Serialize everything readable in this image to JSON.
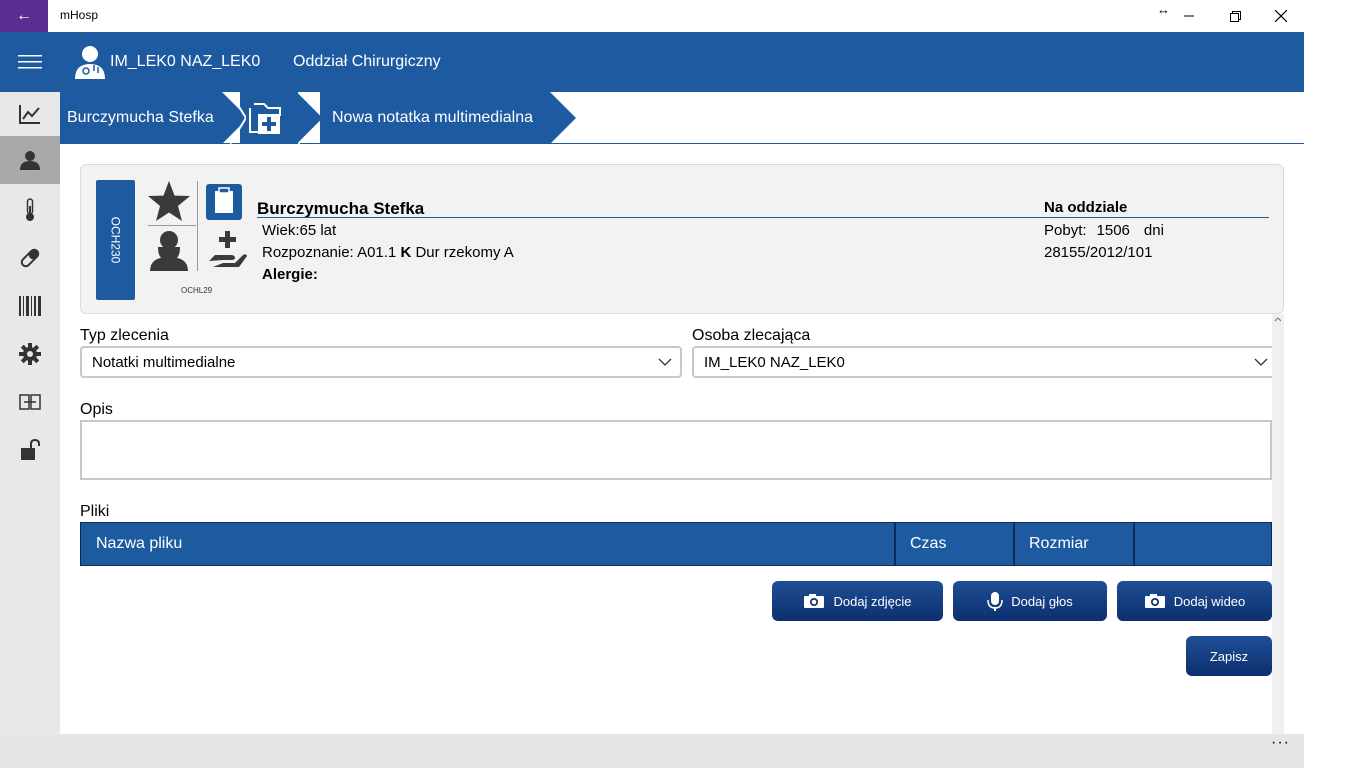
{
  "window": {
    "title": "mHosp",
    "back_symbol": "←",
    "resize_symbol": "↔"
  },
  "header": {
    "user": "IM_LEK0 NAZ_LEK0",
    "department": "Oddział Chirurgiczny"
  },
  "breadcrumb": {
    "patient": "Burczymucha Stefka",
    "page": "Nowa notatka multimedialna"
  },
  "patient": {
    "bed": "OCH230",
    "room": "OCHL29",
    "name": "Burczymucha Stefka",
    "age": "Wiek:65 lat",
    "diagnosis_prefix": "Rozpoznanie: A01.1 ",
    "diagnosis_flag": "K",
    "diagnosis_text": " Dur rzekomy A",
    "allergies": "Alergie:",
    "status": "Na oddziale",
    "stay_label": "Pobyt:",
    "stay_value": "1506",
    "stay_unit": "dni",
    "case_number": "28155/2012/101"
  },
  "form": {
    "order_type_label": "Typ zlecenia",
    "order_type_value": "Notatki multimedialne",
    "ordering_person_label": "Osoba zlecająca",
    "ordering_person_value": "IM_LEK0 NAZ_LEK0",
    "description_label": "Opis",
    "description_value": "",
    "files_label": "Pliki"
  },
  "files_table": {
    "columns": [
      "Nazwa pliku",
      "Czas",
      "Rozmiar",
      ""
    ],
    "rows": []
  },
  "buttons": {
    "add_photo": "Dodaj zdjęcie",
    "add_voice": "Dodaj głos",
    "add_video": "Dodaj wideo",
    "save": "Zapisz"
  },
  "bottom": {
    "more": "···"
  },
  "colors": {
    "primary": "#1e5aa0",
    "button": "#0d2f6e",
    "accent_titlebar": "#5c2d91",
    "sidebar_bg": "#e8e8e8",
    "sidebar_active": "#a9a9a9"
  }
}
